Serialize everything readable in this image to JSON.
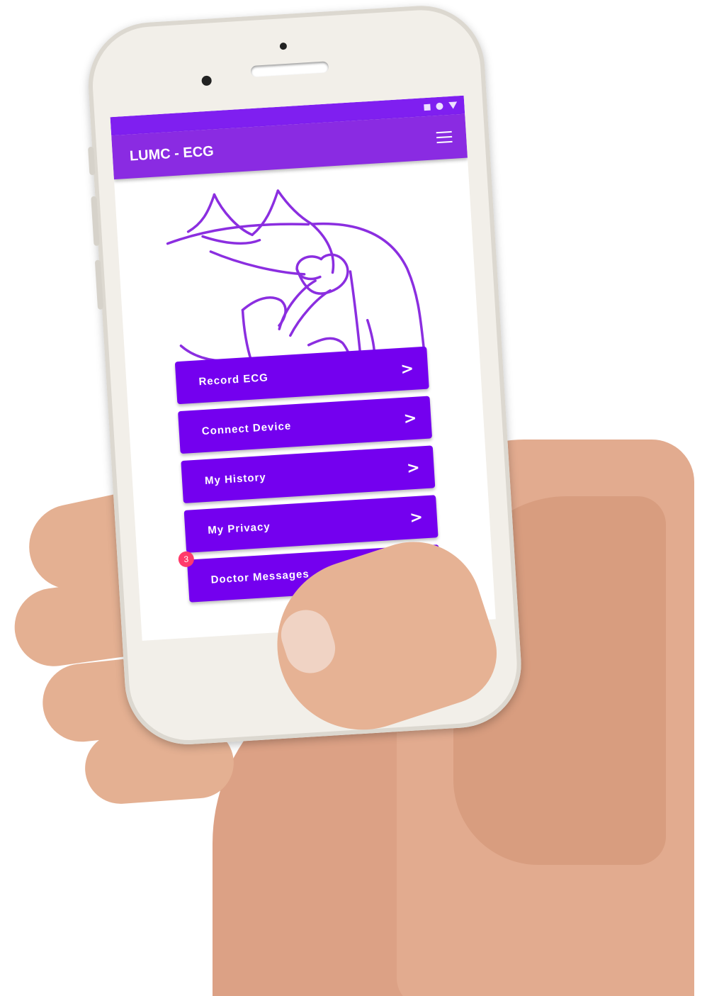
{
  "status_bar": {
    "icons": [
      "square-icon",
      "circle-icon",
      "triangle-icon"
    ],
    "color": "#7f1ff0"
  },
  "app_bar": {
    "title": "LUMC - ECG",
    "menu_icon": "hamburger-menu-icon",
    "color": "#8a2be2"
  },
  "illustration": {
    "description_icon": "chest-device-illustration-icon",
    "stroke_color": "#8b2ee0"
  },
  "menu": {
    "items": [
      {
        "label": "Record ECG",
        "icon": "chevron-right-icon",
        "chevron": ">"
      },
      {
        "label": "Connect Device",
        "icon": "chevron-right-icon",
        "chevron": ">"
      },
      {
        "label": "My History",
        "icon": "chevron-right-icon",
        "chevron": ">"
      },
      {
        "label": "My Privacy",
        "icon": "chevron-right-icon",
        "chevron": ">"
      },
      {
        "label": "Doctor Messages",
        "badge": "3",
        "badge_color": "#ff3b6b"
      }
    ],
    "button_color": "#7400ef"
  }
}
